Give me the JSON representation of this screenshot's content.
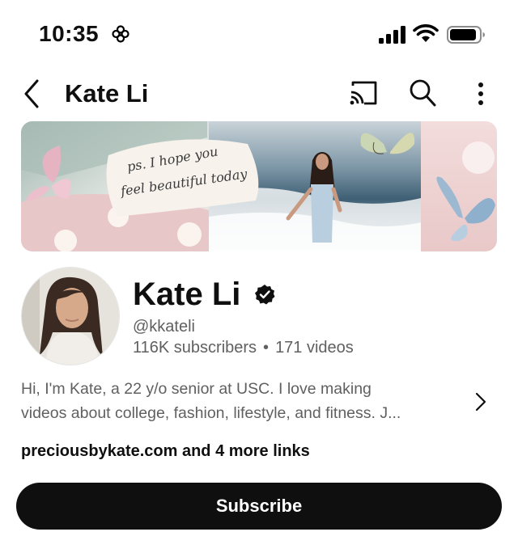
{
  "status_bar": {
    "time": "10:35",
    "icons": [
      "focus-flower-icon",
      "signal-icon",
      "wifi-icon",
      "battery-icon"
    ]
  },
  "header": {
    "title": "Kate Li",
    "icons": [
      "back-icon",
      "cast-icon",
      "search-icon",
      "more-icon"
    ]
  },
  "banner": {
    "handwritten_text_1": "ps. I hope you",
    "handwritten_text_2": "feel beautiful today"
  },
  "profile": {
    "name": "Kate Li",
    "verified": true,
    "handle": "@kkateli",
    "subscribers": "116K subscribers",
    "separator": "•",
    "videos": "171 videos"
  },
  "description": {
    "line1": "Hi, I'm Kate, a 22 y/o senior at USC. I love making",
    "line2": "videos about college, fashion, lifestyle, and fitness. J..."
  },
  "links": {
    "label": "preciousbykate.com and 4 more links"
  },
  "actions": {
    "subscribe_label": "Subscribe"
  },
  "colors": {
    "text": "#0f0f0f",
    "secondary_text": "#606060",
    "button_bg": "#0f0f0f",
    "button_text": "#ffffff"
  }
}
